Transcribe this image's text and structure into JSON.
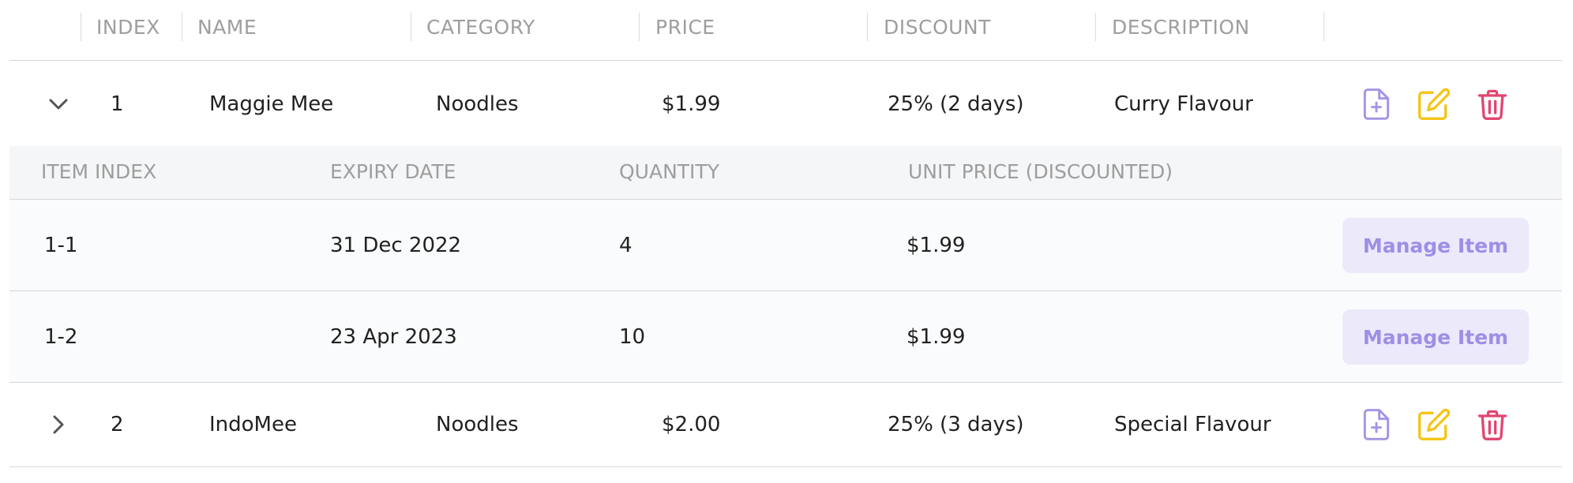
{
  "columns": [
    "INDEX",
    "NAME",
    "CATEGORY",
    "PRICE",
    "DISCOUNT",
    "DESCRIPTION"
  ],
  "products": [
    {
      "index": "1",
      "name": "Maggie Mee",
      "category": "Noodles",
      "price": "$1.99",
      "discount": "25% (2 days)",
      "description": "Curry Flavour",
      "expanded": true
    },
    {
      "index": "2",
      "name": "IndoMee",
      "category": "Noodles",
      "price": "$2.00",
      "discount": "25% (3 days)",
      "description": "Special Flavour",
      "expanded": false
    }
  ],
  "item_columns": [
    "ITEM INDEX",
    "EXPIRY DATE",
    "QUANTITY",
    "UNIT PRICE (DISCOUNTED)"
  ],
  "items": [
    {
      "item_index": "1-1",
      "expiry_date": "31 Dec 2022",
      "quantity": "4",
      "unit_price": "$1.99",
      "action_label": "Manage Item"
    },
    {
      "item_index": "1-2",
      "expiry_date": "23 Apr 2023",
      "quantity": "10",
      "unit_price": "$1.99",
      "action_label": "Manage Item"
    }
  ],
  "icons": {
    "expanded_toggle": "chevron-down-icon",
    "collapsed_toggle": "chevron-right-icon",
    "add": "file-plus-icon",
    "edit": "edit-icon",
    "delete": "trash-icon"
  },
  "colors": {
    "add_icon": "#a394e6",
    "edit_icon": "#f5c518",
    "delete_icon": "#e2456f",
    "manage_button_bg": "#ece9fb",
    "manage_button_text": "#9f8ee6"
  }
}
